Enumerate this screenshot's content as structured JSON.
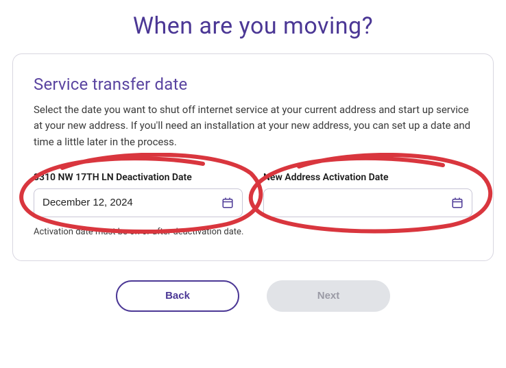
{
  "page": {
    "title": "When are you moving?"
  },
  "card": {
    "heading": "Service transfer date",
    "description": "Select the date you want to shut off internet service at your current address and start up service at your new address. If you'll need an installation at your new address, you can set up a date and time a little later in the process."
  },
  "fields": {
    "deactivation": {
      "label": "3310 NW 17TH LN Deactivation Date",
      "value": "December 12, 2024"
    },
    "activation": {
      "label": "New Address Activation Date",
      "value": ""
    }
  },
  "helper": "Activation date must be on or after deactivation date.",
  "buttons": {
    "back": "Back",
    "next": "Next"
  },
  "colors": {
    "accent": "#4b3795",
    "annotation": "#d9363e"
  }
}
